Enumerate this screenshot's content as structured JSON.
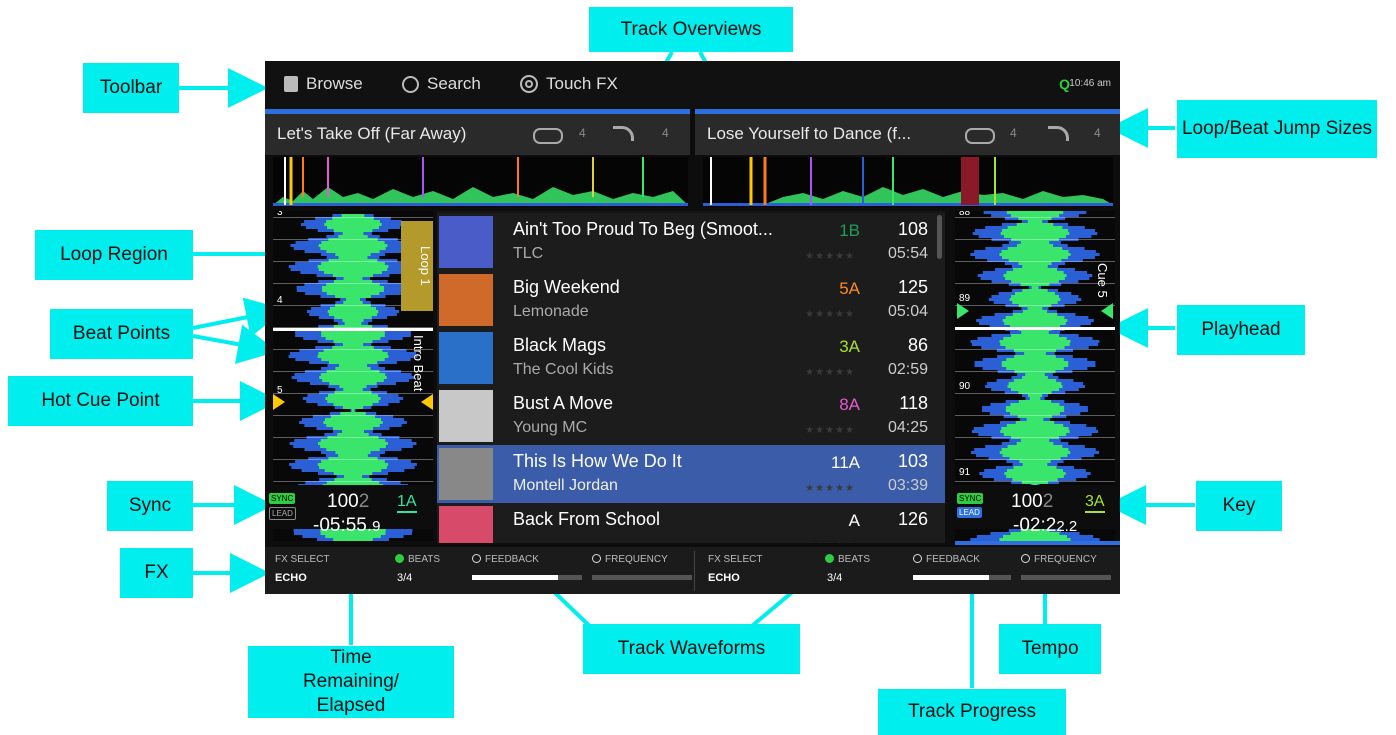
{
  "callouts": {
    "toolbar": "Toolbar",
    "track_overviews": "Track Overviews",
    "loop_beat_jump": "Loop/Beat Jump Sizes",
    "loop_region": "Loop Region",
    "beat_points": "Beat Points",
    "playhead": "Playhead",
    "hot_cue": "Hot Cue Point",
    "sync": "Sync",
    "key": "Key",
    "fx": "FX",
    "time_remaining": "Time Remaining/ Elapsed",
    "track_waveforms": "Track Waveforms",
    "tempo": "Tempo",
    "track_progress": "Track Progress"
  },
  "toolbar": {
    "browse": "Browse",
    "search": "Search",
    "touch_fx": "Touch FX",
    "quantize": "Q",
    "clock": "10:46 am"
  },
  "deck_left": {
    "title": "Let's Take Off (Far Away)",
    "loop_size": "4",
    "jump_size": "4",
    "loop_label": "Loop 1",
    "cue_label": "Intro Beat",
    "beat_3": "3",
    "beat_4": "4",
    "beat_5": "5",
    "sync": "SYNC",
    "lead": "LEAD",
    "bpm_main": "100",
    "bpm_frac": "2",
    "key": "1A",
    "time_main": "-05:55.",
    "time_frac": "9"
  },
  "deck_right": {
    "title": "Lose Yourself to Dance (f...",
    "loop_size": "4",
    "jump_size": "4",
    "cue_label": "Cue 5",
    "beat_88": "88",
    "beat_89": "89",
    "beat_90": "90",
    "beat_91": "91",
    "sync": "SYNC",
    "lead": "LEAD",
    "bpm_main": "100",
    "bpm_frac": "2",
    "key": "3A",
    "time_main": "-02:2",
    "time_frac": "2.2"
  },
  "tracks": [
    {
      "title": "Ain't Too Proud To Beg (Smoot...",
      "artist": "TLC",
      "key": "1B",
      "key_color": "#1f9e5a",
      "bpm": "108",
      "duration": "05:54",
      "art": "cover-icon"
    },
    {
      "title": "Big Weekend",
      "artist": "Lemonade",
      "key": "5A",
      "key_color": "#ff8a1f",
      "bpm": "125",
      "duration": "05:04",
      "art": "cover-icon"
    },
    {
      "title": "Black Mags",
      "artist": "The Cool Kids",
      "key": "3A",
      "key_color": "#a6e22e",
      "bpm": "86",
      "duration": "02:59",
      "art": "cover-icon"
    },
    {
      "title": "Bust A Move",
      "artist": "Young MC",
      "key": "8A",
      "key_color": "#e65ad0",
      "bpm": "118",
      "duration": "04:25",
      "art": "cover-icon"
    },
    {
      "title": "This Is How We Do It",
      "artist": "Montell Jordan",
      "key": "11A",
      "key_color": "#ffffff",
      "bpm": "103",
      "duration": "03:39",
      "art": "cover-icon"
    },
    {
      "title": "Back From School",
      "artist": "",
      "key": "A",
      "key_color": "#ffffff",
      "bpm": "126",
      "duration": "",
      "art": "cover-icon"
    }
  ],
  "fx_left": {
    "select_label": "FX SELECT",
    "select_value": "ECHO",
    "beats_label": "BEATS",
    "beats_value": "3/4",
    "feedback_label": "FEEDBACK",
    "frequency_label": "FREQUENCY",
    "feedback_level": 0.78
  },
  "fx_right": {
    "select_label": "FX SELECT",
    "select_value": "ECHO",
    "beats_label": "BEATS",
    "beats_value": "3/4",
    "feedback_label": "FEEDBACK",
    "frequency_label": "FREQUENCY",
    "feedback_level": 0.78
  },
  "colors": {
    "callout_bg": "#00eeee",
    "accent_blue": "#2d6fe0",
    "waveform_green": "#39e66b",
    "waveform_blue": "#2a5fd6",
    "loop_gold": "#b49a2a",
    "cue_yellow": "#ffc800",
    "sync_green": "#2ecc40"
  }
}
